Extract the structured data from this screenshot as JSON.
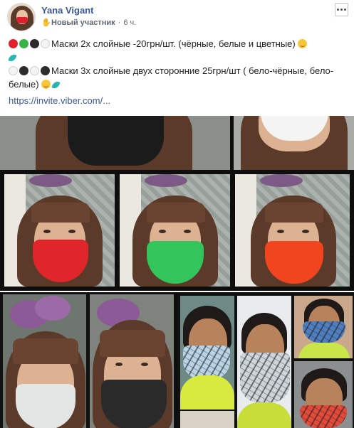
{
  "post": {
    "author": "Yana Vigant",
    "badge": "Новый участник",
    "separator": "·",
    "time": "6 ч.",
    "lines": [
      {
        "emojis_before": [
          "red-circle",
          "green-circle",
          "black-circle",
          "white-circle"
        ],
        "text": "Маски 2х слойные -20грн/шт. (чёрные, белые и цветные)",
        "emojis_after": [
          "smiling-face",
          "feather"
        ]
      },
      {
        "emojis_before": [
          "white-circle",
          "black-circle",
          "white-circle",
          "black-circle"
        ],
        "text": "Маски 3х слойные двух сторонние 25грн/шт ( бело-чёрные, бело-белые)",
        "emojis_after": [
          "smiling-face",
          "feather"
        ]
      }
    ],
    "link": "https://invite.viber.com/..."
  },
  "photos": [
    {
      "name": "photo-black-mask-top-left",
      "mask_color": "#1b1b1b"
    },
    {
      "name": "photo-white-mask-top-right",
      "mask_color": "#f4f4f4"
    },
    {
      "name": "photo-red-mask",
      "mask_color": "#e1262b"
    },
    {
      "name": "photo-green-mask",
      "mask_color": "#34c45c"
    },
    {
      "name": "photo-orange-mask",
      "mask_color": "#f1451f"
    },
    {
      "name": "photo-bw-masks-collage",
      "mask_color": "#d8dadb"
    },
    {
      "name": "photo-kids-masks-collage",
      "mask_color": "#9fb6c6"
    }
  ],
  "icons": {
    "badge": "waving-hand-icon",
    "more": "more-options-icon"
  },
  "colors": {
    "link": "#385898",
    "meta": "#606770",
    "text": "#1c1e21"
  }
}
